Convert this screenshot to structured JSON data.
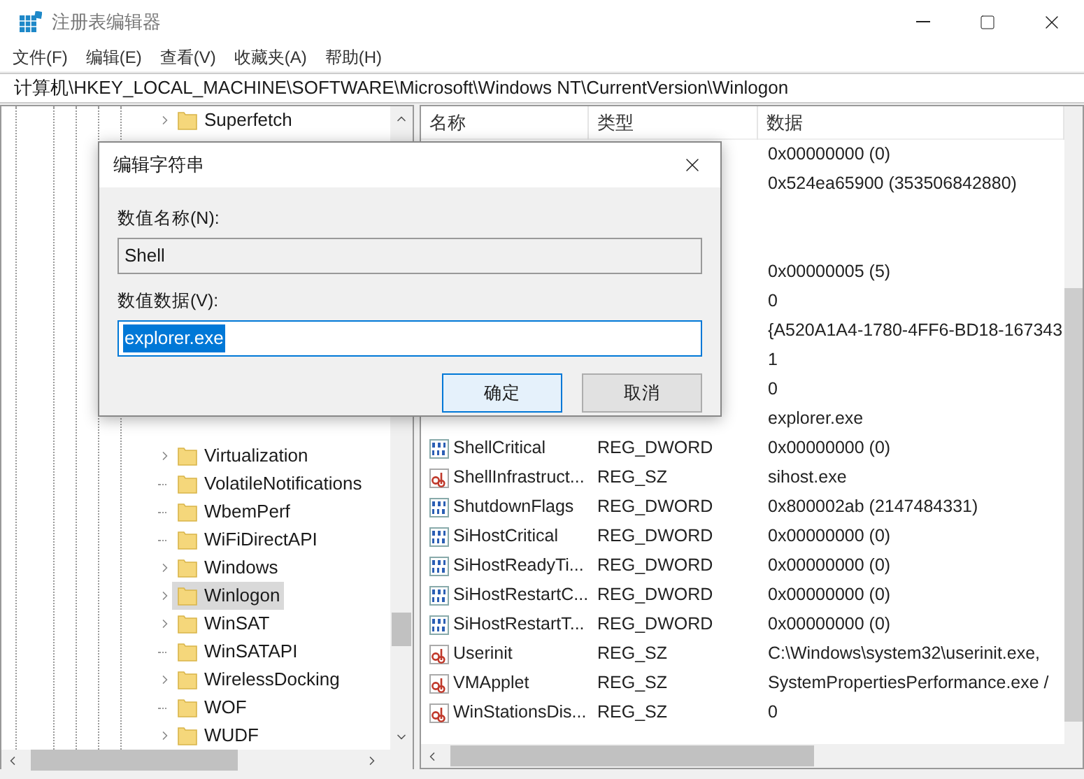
{
  "window": {
    "title": "注册表编辑器"
  },
  "menu": [
    "文件(F)",
    "编辑(E)",
    "查看(V)",
    "收藏夹(A)",
    "帮助(H)"
  ],
  "address": "计算机\\HKEY_LOCAL_MACHINE\\SOFTWARE\\Microsoft\\Windows NT\\CurrentVersion\\Winlogon",
  "tree": {
    "top_items": [
      {
        "label": "Superfetch",
        "expandable": true,
        "selected": false
      }
    ],
    "bottom_items": [
      {
        "label": "Virtualization",
        "expandable": true,
        "selected": false
      },
      {
        "label": "VolatileNotifications",
        "expandable": false,
        "selected": false
      },
      {
        "label": "WbemPerf",
        "expandable": false,
        "selected": false
      },
      {
        "label": "WiFiDirectAPI",
        "expandable": false,
        "selected": false
      },
      {
        "label": "Windows",
        "expandable": true,
        "selected": false
      },
      {
        "label": "Winlogon",
        "expandable": true,
        "selected": true
      },
      {
        "label": "WinSAT",
        "expandable": true,
        "selected": false
      },
      {
        "label": "WinSATAPI",
        "expandable": false,
        "selected": false
      },
      {
        "label": "WirelessDocking",
        "expandable": true,
        "selected": false
      },
      {
        "label": "WOF",
        "expandable": false,
        "selected": false
      },
      {
        "label": "WUDF",
        "expandable": true,
        "selected": false
      }
    ]
  },
  "list": {
    "columns": [
      "名称",
      "类型",
      "数据"
    ],
    "rows": [
      {
        "kind": "covered",
        "data": "0x00000000 (0)"
      },
      {
        "kind": "covered",
        "data": "0x524ea65900 (353506842880)"
      },
      {
        "kind": "covered"
      },
      {
        "kind": "covered"
      },
      {
        "kind": "covered",
        "data": "0x00000005 (5)"
      },
      {
        "kind": "covered",
        "data": "0"
      },
      {
        "kind": "covered",
        "data": "{A520A1A4-1780-4FF6-BD18-167343"
      },
      {
        "kind": "covered",
        "data": "1"
      },
      {
        "kind": "covered",
        "data": "0"
      },
      {
        "kind": "covered",
        "data": "explorer.exe"
      },
      {
        "kind": "dword",
        "name": "ShellCritical",
        "type": "REG_DWORD",
        "data": "0x00000000 (0)"
      },
      {
        "kind": "sz",
        "name": "ShellInfrastruct...",
        "type": "REG_SZ",
        "data": "sihost.exe"
      },
      {
        "kind": "dword",
        "name": "ShutdownFlags",
        "type": "REG_DWORD",
        "data": "0x800002ab (2147484331)"
      },
      {
        "kind": "dword",
        "name": "SiHostCritical",
        "type": "REG_DWORD",
        "data": "0x00000000 (0)"
      },
      {
        "kind": "dword",
        "name": "SiHostReadyTi...",
        "type": "REG_DWORD",
        "data": "0x00000000 (0)"
      },
      {
        "kind": "dword",
        "name": "SiHostRestartC...",
        "type": "REG_DWORD",
        "data": "0x00000000 (0)"
      },
      {
        "kind": "dword",
        "name": "SiHostRestartT...",
        "type": "REG_DWORD",
        "data": "0x00000000 (0)"
      },
      {
        "kind": "sz",
        "name": "Userinit",
        "type": "REG_SZ",
        "data": "C:\\Windows\\system32\\userinit.exe,"
      },
      {
        "kind": "sz",
        "name": "VMApplet",
        "type": "REG_SZ",
        "data": "SystemPropertiesPerformance.exe /"
      },
      {
        "kind": "sz",
        "name": "WinStationsDis...",
        "type": "REG_SZ",
        "data": "0"
      }
    ]
  },
  "dialog": {
    "title": "编辑字符串",
    "name_label": "数值名称(N):",
    "name_value": "Shell",
    "data_label": "数值数据(V):",
    "data_value": "explorer.exe",
    "data_selected": true,
    "buttons": [
      {
        "label": "确定",
        "default": true
      },
      {
        "label": "取消",
        "default": false
      }
    ]
  }
}
